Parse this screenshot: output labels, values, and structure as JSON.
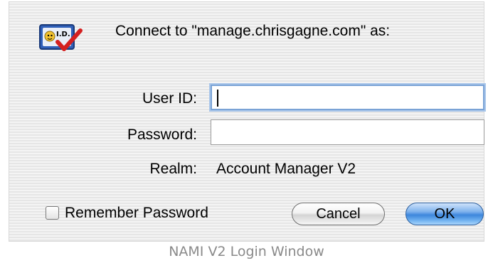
{
  "dialog": {
    "icon": "id-card-checkmark-icon",
    "icon_text": "I.D.",
    "title": "Connect to \"manage.chrisgagne.com\" as:",
    "user_id_label": "User ID:",
    "user_id_value": "",
    "password_label": "Password:",
    "password_value": "",
    "realm_label": "Realm:",
    "realm_value": "Account Manager V2",
    "remember_label": "Remember Password",
    "remember_checked": false,
    "cancel_label": "Cancel",
    "ok_label": "OK"
  },
  "caption": "NAMI V2 Login Window",
  "colors": {
    "focus_ring": "#7aa3d6",
    "ok_button": "#3d86dc",
    "caption_text": "#8a8a8a"
  }
}
